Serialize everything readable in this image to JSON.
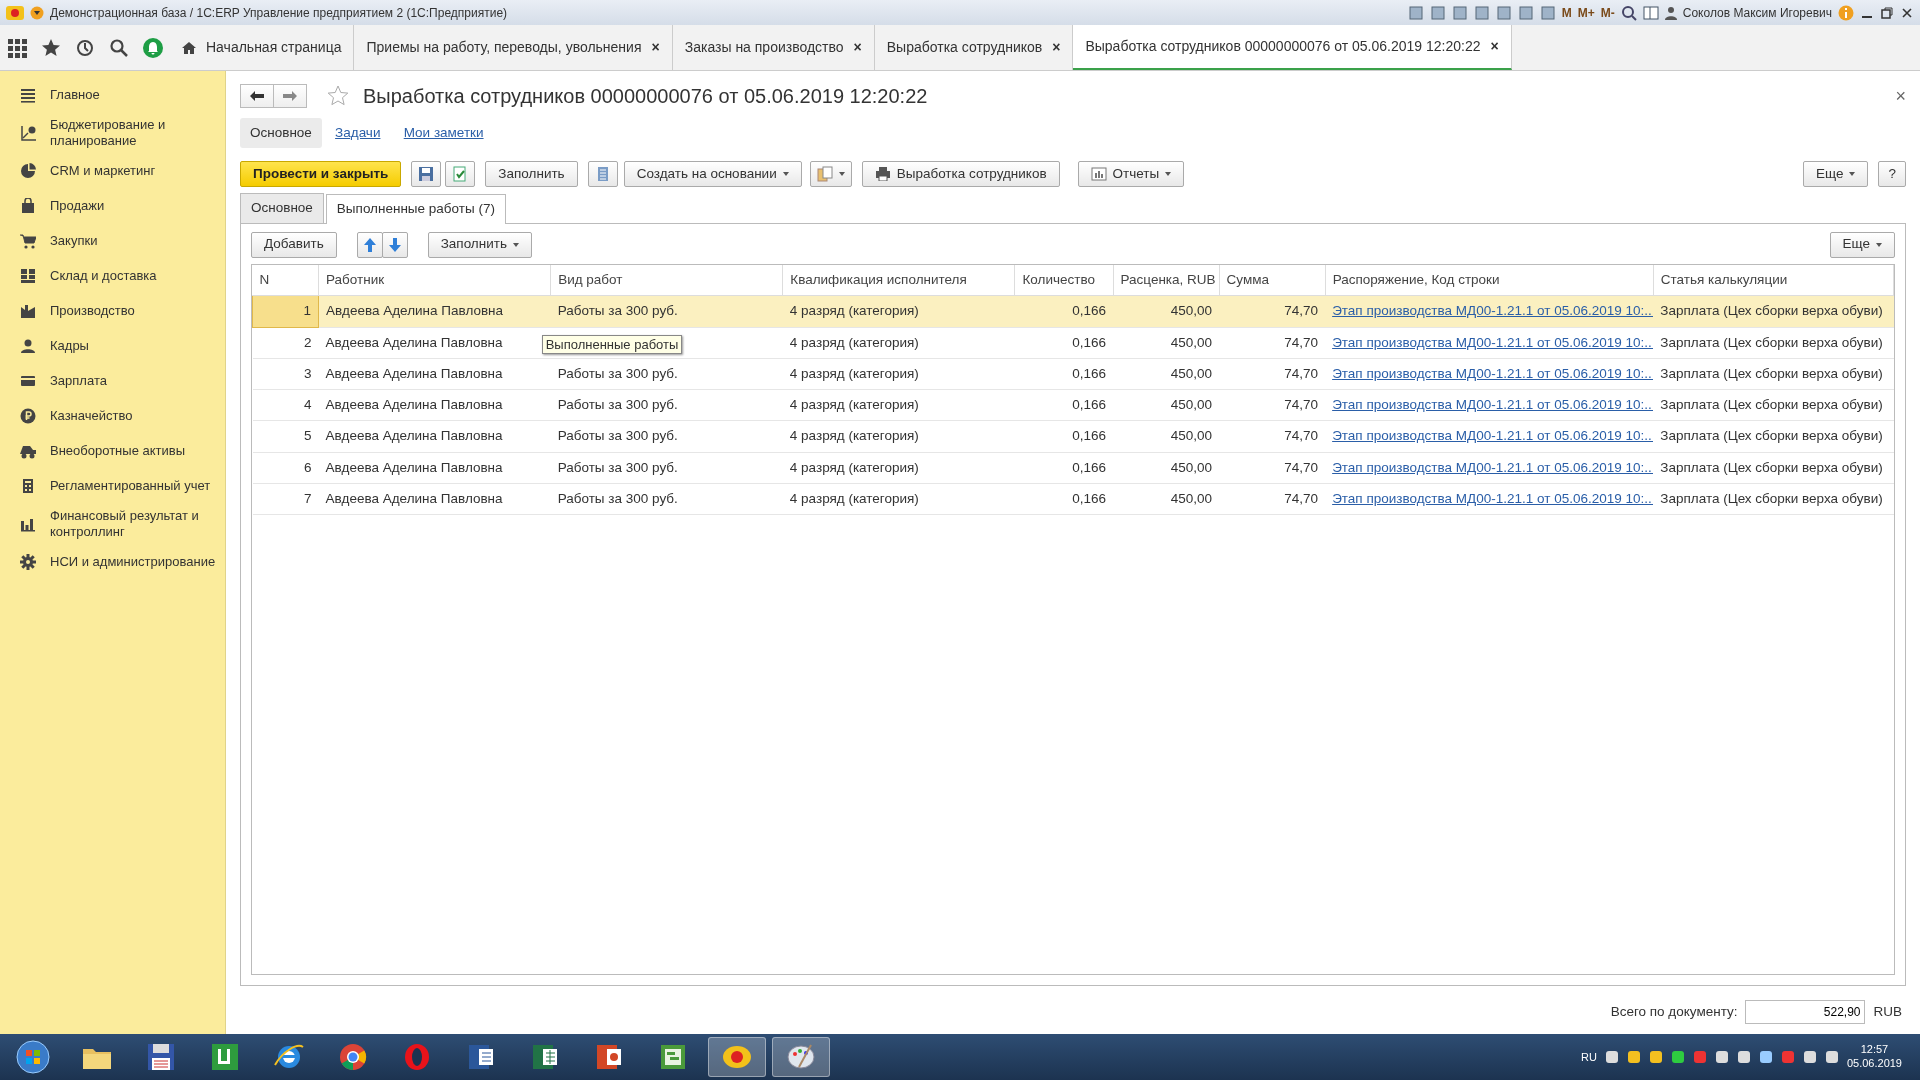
{
  "window": {
    "title": "Демонстрационная база / 1С:ERP Управление предприятием 2  (1С:Предприятие)",
    "memory_buttons": [
      "M",
      "M+",
      "M-"
    ],
    "user": "Соколов Максим Игоревич"
  },
  "open_tabs": [
    {
      "label": "Начальная страница",
      "kind": "home",
      "selected": false
    },
    {
      "label": "Приемы на работу, переводы, увольнения",
      "kind": "doc",
      "selected": false
    },
    {
      "label": "Заказы на производство",
      "kind": "doc",
      "selected": false
    },
    {
      "label": "Выработка сотрудников",
      "kind": "doc",
      "selected": false
    },
    {
      "label": "Выработка сотрудников 00000000076 от 05.06.2019 12:20:22",
      "kind": "doc",
      "selected": true
    }
  ],
  "close_mark": "×",
  "sidebar": {
    "items": [
      {
        "label": "Главное"
      },
      {
        "label": "Бюджетирование и планирование"
      },
      {
        "label": "CRM и маркетинг"
      },
      {
        "label": "Продажи"
      },
      {
        "label": "Закупки"
      },
      {
        "label": "Склад и доставка"
      },
      {
        "label": "Производство"
      },
      {
        "label": "Кадры"
      },
      {
        "label": "Зарплата"
      },
      {
        "label": "Казначейство"
      },
      {
        "label": "Внеоборотные активы"
      },
      {
        "label": "Регламентированный учет"
      },
      {
        "label": "Финансовый результат и контроллинг"
      },
      {
        "label": "НСИ и администрирование"
      }
    ]
  },
  "document": {
    "title": "Выработка сотрудников 00000000076 от 05.06.2019 12:20:22",
    "close_mark": "×",
    "sections": [
      {
        "label": "Основное",
        "selected": true
      },
      {
        "label": "Задачи",
        "selected": false
      },
      {
        "label": "Мои заметки",
        "selected": false
      }
    ],
    "toolbar": [
      {
        "kind": "primary",
        "label": "Провести и закрыть"
      },
      {
        "kind": "icon"
      },
      {
        "kind": "icon"
      },
      {
        "kind": "text",
        "label": "Заполнить"
      },
      {
        "kind": "icon"
      },
      {
        "kind": "dropdown",
        "label": "Создать на основании"
      },
      {
        "kind": "icondrop"
      },
      {
        "kind": "print",
        "label": "Выработка сотрудников"
      },
      {
        "kind": "report",
        "label": "Отчеты"
      }
    ],
    "more_button": "Еще",
    "help_button": "?",
    "inner_tabs": [
      {
        "label": "Основное",
        "selected": false
      },
      {
        "label": "Выполненные работы (7)",
        "selected": true
      }
    ],
    "table_toolbar": {
      "add_button": "Добавить",
      "fill_button": "Заполнить",
      "more_button": "Еще"
    },
    "table": {
      "columns": [
        "N",
        "Работник",
        "Вид работ",
        "Квалификация исполнителя",
        "Количество",
        "Расценка, RUB",
        "Сумма",
        "Распоряжение, Код строки",
        "Статья калькуляции"
      ],
      "rows": [
        {
          "n": "1",
          "worker": "Авдеева Аделина Павловна",
          "work_type": "Работы за 300 руб.",
          "qualification": "4 разряд (категория)",
          "quantity": "0,166",
          "rate": "450,00",
          "sum": "74,70",
          "order": "Этап производства МД00-1.21.1 от 05.06.2019 10:...",
          "article": "Зарплата (Цех сборки верха обуви)",
          "selected": true
        },
        {
          "n": "2",
          "worker": "Авдеева Аделина Павловна",
          "tooltip": "Выполненные работы",
          "qualification": "4 разряд (категория)",
          "quantity": "0,166",
          "rate": "450,00",
          "sum": "74,70",
          "order": "Этап производства МД00-1.21.1 от 05.06.2019 10:...",
          "article": "Зарплата (Цех сборки верха обуви)",
          "selected": false
        },
        {
          "n": "3",
          "worker": "Авдеева Аделина Павловна",
          "work_type": "Работы за 300 руб.",
          "qualification": "4 разряд (категория)",
          "quantity": "0,166",
          "rate": "450,00",
          "sum": "74,70",
          "order": "Этап производства МД00-1.21.1 от 05.06.2019 10:...",
          "article": "Зарплата (Цех сборки верха обуви)",
          "selected": false
        },
        {
          "n": "4",
          "worker": "Авдеева Аделина Павловна",
          "work_type": "Работы за 300 руб.",
          "qualification": "4 разряд (категория)",
          "quantity": "0,166",
          "rate": "450,00",
          "sum": "74,70",
          "order": "Этап производства МД00-1.21.1 от 05.06.2019 10:...",
          "article": "Зарплата (Цех сборки верха обуви)",
          "selected": false
        },
        {
          "n": "5",
          "worker": "Авдеева Аделина Павловна",
          "work_type": "Работы за 300 руб.",
          "qualification": "4 разряд (категория)",
          "quantity": "0,166",
          "rate": "450,00",
          "sum": "74,70",
          "order": "Этап производства МД00-1.21.1 от 05.06.2019 10:...",
          "article": "Зарплата (Цех сборки верха обуви)",
          "selected": false
        },
        {
          "n": "6",
          "worker": "Авдеева Аделина Павловна",
          "work_type": "Работы за 300 руб.",
          "qualification": "4 разряд (категория)",
          "quantity": "0,166",
          "rate": "450,00",
          "sum": "74,70",
          "order": "Этап производства МД00-1.21.1 от 05.06.2019 10:...",
          "article": "Зарплата (Цех сборки верха обуви)",
          "selected": false
        },
        {
          "n": "7",
          "worker": "Авдеева Аделина Павловна",
          "work_type": "Работы за 300 руб.",
          "qualification": "4 разряд (категория)",
          "quantity": "0,166",
          "rate": "450,00",
          "sum": "74,70",
          "order": "Этап производства МД00-1.21.1 от 05.06.2019 10:...",
          "article": "Зарплата (Цех сборки верха обуви)",
          "selected": false
        }
      ]
    },
    "total": {
      "label": "Всего по документу:",
      "value": "522,90",
      "currency": "RUB"
    }
  },
  "taskbar": {
    "apps": [
      {
        "active": false
      },
      {
        "active": false
      },
      {
        "active": false
      },
      {
        "active": false
      },
      {
        "active": false
      },
      {
        "active": false
      },
      {
        "active": false
      },
      {
        "active": false
      },
      {
        "active": false
      },
      {
        "active": false
      },
      {
        "active": true
      },
      {
        "active": true
      }
    ],
    "language": "RU",
    "time": "12:57",
    "date": "05.06.2019"
  }
}
